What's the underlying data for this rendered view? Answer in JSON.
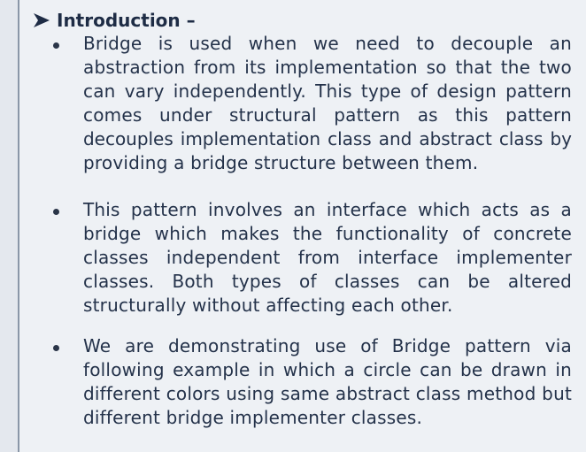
{
  "heading": {
    "text": "Introduction –",
    "icon": "arrow-bullet-icon"
  },
  "bullets": [
    {
      "lines": [
        "Bridge is used when we need to decouple an",
        "abstraction from its implementation so that the two",
        "can vary independently. This type of design pattern",
        "comes under structural pattern as this pattern",
        "decouples implementation class and abstract class by",
        "providing a bridge structure between them."
      ]
    },
    {
      "lines": [
        "This pattern involves an interface which acts as a",
        "bridge which makes the functionality of concrete",
        "classes independent from interface implementer",
        "classes. Both types of classes can be altered",
        "structurally without affecting each other."
      ]
    },
    {
      "lines": [
        "We are demonstrating use of Bridge pattern via",
        "following example in which a circle can be drawn in",
        "different colors using same abstract class method but",
        "different bridge implementer classes."
      ]
    }
  ]
}
